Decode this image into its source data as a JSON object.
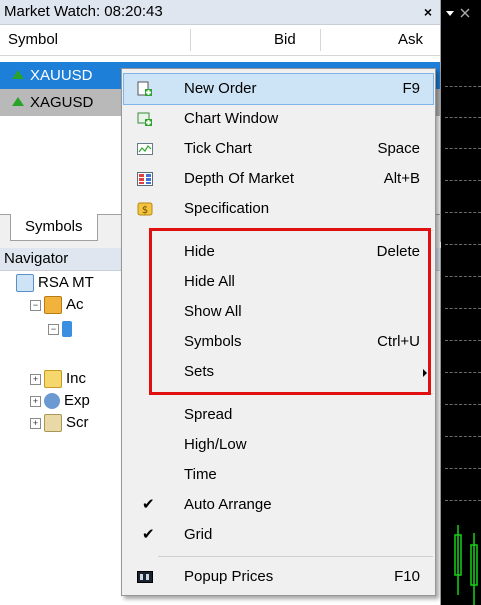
{
  "market_watch": {
    "title": "Market Watch: 08:20:43",
    "close": "×",
    "columns": {
      "symbol": "Symbol",
      "bid": "Bid",
      "ask": "Ask"
    },
    "rows": [
      {
        "symbol": "XAUUSD"
      },
      {
        "symbol": "XAGUSD"
      }
    ],
    "tab": "Symbols"
  },
  "navigator": {
    "title": "Navigator",
    "items": [
      {
        "label": "RSA MT"
      },
      {
        "label": "Ac"
      },
      {
        "label": "Inc"
      },
      {
        "label": "Exp"
      },
      {
        "label": "Scr"
      }
    ]
  },
  "context_menu": {
    "items": [
      {
        "label": "New Order",
        "shortcut": "F9",
        "icon": "new-order-icon"
      },
      {
        "label": "Chart Window",
        "shortcut": "",
        "icon": "chart-window-icon"
      },
      {
        "label": "Tick Chart",
        "shortcut": "Space",
        "icon": "tick-chart-icon"
      },
      {
        "label": "Depth Of Market",
        "shortcut": "Alt+B",
        "icon": "depth-of-market-icon"
      },
      {
        "label": "Specification",
        "shortcut": "",
        "icon": "specification-icon"
      },
      {
        "label": "Hide",
        "shortcut": "Delete"
      },
      {
        "label": "Hide All",
        "shortcut": ""
      },
      {
        "label": "Show All",
        "shortcut": ""
      },
      {
        "label": "Symbols",
        "shortcut": "Ctrl+U"
      },
      {
        "label": "Sets",
        "shortcut": ""
      },
      {
        "label": "Spread",
        "shortcut": ""
      },
      {
        "label": "High/Low",
        "shortcut": ""
      },
      {
        "label": "Time",
        "shortcut": ""
      },
      {
        "label": "Auto Arrange",
        "shortcut": "",
        "checked": true
      },
      {
        "label": "Grid",
        "shortcut": "",
        "checked": true
      },
      {
        "label": "Popup Prices",
        "shortcut": "F10",
        "icon": "popup-prices-icon"
      }
    ],
    "checkmark": "✔"
  },
  "colors": {
    "selection": "#1e7fd8",
    "highlight_outline": "#e01010",
    "chart_bg": "#000000"
  }
}
